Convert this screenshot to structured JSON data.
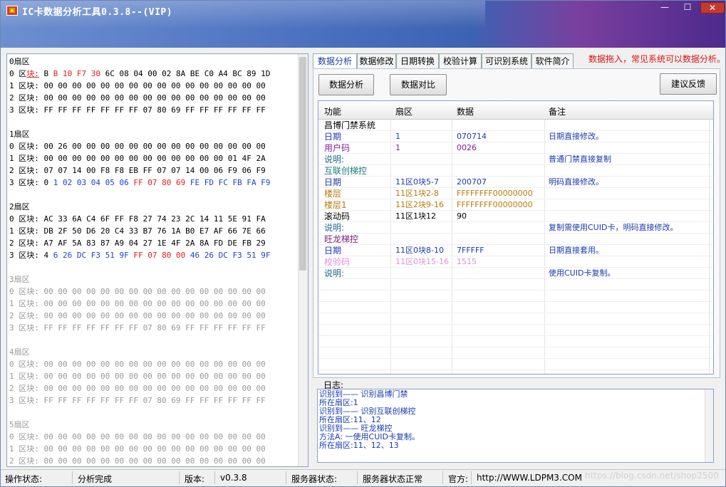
{
  "window": {
    "title": "IC卡数据分析工具0.3.8--(VIP)",
    "min": "—",
    "max": "☐",
    "close": "✕"
  },
  "hex": {
    "lines": [
      [
        "0扇区",
        ""
      ],
      [
        "0 区块: BB 10 F7 30 6C 08 04 00 02 8A BE C0 A4 BC 89 1D",
        "first"
      ],
      [
        "1 区块: 00 00 00 00 00 00 00 00 00 00 00 00 00 00 00 00",
        ""
      ],
      [
        "2 区块: 00 00 00 00 00 00 00 00 00 00 00 00 00 00 00 00",
        ""
      ],
      [
        "3 区块: FF FF FF FF FF FF FF 07 80 69 FF FF FF FF FF FF",
        ""
      ],
      [
        "",
        ""
      ],
      [
        "1扇区",
        ""
      ],
      [
        "0 区块: 00 26 00 00 00 00 00 00 00 00 00 00 00 00 00 00",
        ""
      ],
      [
        "1 区块: 00 00 00 00 00 00 00 00 00 00 00 00 00 01 4F 2A",
        ""
      ],
      [
        "2 区块: 07 07 14 00 F8 F8 EB FF 07 07 14 00 06 F9 06 F9",
        ""
      ],
      [
        "3 区块: 01 02 03 04 05 06 FF 07 80 69 FE FD FC FB FA F9",
        "trailer"
      ],
      [
        "",
        ""
      ],
      [
        "2扇区",
        ""
      ],
      [
        "0 区块: AC 33 6A C4 6F FF F8 27 74 23 2C 14 11 5E 91 FA",
        ""
      ],
      [
        "1 区块: DB 2F 50 D6 20 C4 33 B7 76 1A B0 E7 AF 66 7E 66",
        ""
      ],
      [
        "2 区块: A7 AF 5A 83 87 A9 04 27 1E 4F 2A 8A FD DE FB 29",
        ""
      ],
      [
        "3 区块: 46 26 DC F3 51 9F FF 07 80 00 46 26 DC F3 51 9F",
        "trailer"
      ],
      [
        "",
        ""
      ],
      [
        "3扇区",
        "gray"
      ],
      [
        "0 区块: 00 00 00 00 00 00 00 00 00 00 00 00 00 00 00 00",
        "gray"
      ],
      [
        "1 区块: 00 00 00 00 00 00 00 00 00 00 00 00 00 00 00 00",
        "gray"
      ],
      [
        "2 区块: 00 00 00 00 00 00 00 00 00 00 00 00 00 00 00 00",
        "gray"
      ],
      [
        "3 区块: FF FF FF FF FF FF FF 07 80 69 FF FF FF FF FF FF",
        "gray"
      ],
      [
        "",
        ""
      ],
      [
        "4扇区",
        "gray"
      ],
      [
        "0 区块: 00 00 00 00 00 00 00 00 00 00 00 00 00 00 00 00",
        "gray"
      ],
      [
        "1 区块: 00 00 00 00 00 00 00 00 00 00 00 00 00 00 00 00",
        "gray"
      ],
      [
        "2 区块: 00 00 00 00 00 00 00 00 00 00 00 00 00 00 00 00",
        "gray"
      ],
      [
        "3 区块: FF FF FF FF FF FF FF 07 80 69 FF FF FF FF FF FF",
        "gray"
      ],
      [
        "",
        ""
      ],
      [
        "5扇区",
        "gray"
      ],
      [
        "0 区块: 00 00 00 00 00 00 00 00 00 00 00 00 00 00 00 00",
        "gray"
      ],
      [
        "1 区块: 00 00 00 00 00 00 00 00 00 00 00 00 00 00 00 00",
        "gray"
      ],
      [
        "2 区块: 00 00 00 00 00 00 00 00 00 00 00 00 00 00 00 00",
        "gray"
      ]
    ]
  },
  "tabs": [
    "数据分析",
    "数据修改",
    "日期转换",
    "校验计算",
    "可识别系统",
    "软件简介"
  ],
  "hint": "数据拖入，常见系统可以数据分析。",
  "buttons": {
    "analyze": "数据分析",
    "compare": "数据对比",
    "feedback": "建议反馈"
  },
  "grid": {
    "headers": [
      "功能",
      "扇区",
      "数据",
      "备注"
    ],
    "rows": [
      {
        "c": [
          "昌博门禁系统",
          "",
          "",
          ""
        ],
        "color": "#000"
      },
      {
        "c": [
          "日期",
          "1",
          "070714",
          "日期直接修改。"
        ],
        "color": "#1a3ab0"
      },
      {
        "c": [
          "用户码",
          "1",
          "0026",
          ""
        ],
        "color": "#8a1a9a"
      },
      {
        "c": [
          "说明:",
          "",
          "",
          "普通门禁直接复制"
        ],
        "color": "#1a6a8a"
      },
      {
        "c": [
          "互联创梯控",
          "",
          "",
          ""
        ],
        "color": "#1a7a7a"
      },
      {
        "c": [
          "日期",
          "11区0块5-7",
          "200707",
          "明码直接修改。"
        ],
        "color": "#1a3ab0"
      },
      {
        "c": [
          "楼层",
          "11区1块2-8",
          "FFFFFFFF00000000",
          ""
        ],
        "color": "#b87a0a"
      },
      {
        "c": [
          "楼层1",
          "11区2块9-16",
          "FFFFFFFF00000000",
          ""
        ],
        "color": "#b87a0a"
      },
      {
        "c": [
          "滚动码",
          "11区1块12",
          "90",
          ""
        ],
        "color": "#000"
      },
      {
        "c": [
          "说明:",
          "",
          "",
          "复制需使用CUID卡，明码直接修改。"
        ],
        "color": "#1a6a8a"
      },
      {
        "c": [
          "旺龙梯控",
          "",
          "",
          ""
        ],
        "color": "#7a1a7a"
      },
      {
        "c": [
          "日期",
          "11区0块8-10",
          "7FFFFF",
          "日期直接套用。"
        ],
        "color": "#1a3ab0"
      },
      {
        "c": [
          "校验码",
          "11区0块15-16",
          "1515",
          ""
        ],
        "color": "#e090d8"
      },
      {
        "c": [
          "说明:",
          "",
          "",
          "使用CUID卡复制。"
        ],
        "color": "#1a6a8a"
      }
    ]
  },
  "log": {
    "label": "日志:",
    "lines": [
      "识别到—— 识别昌博门禁",
      "所在扇区:1",
      "识别到—— 识别互联创梯控",
      "所在扇区:11、12",
      "识别到—— 旺龙梯控",
      "方法A: 一使用CUID卡复制。",
      "所在扇区:11、12、13"
    ]
  },
  "status": {
    "op_label": "操作状态:",
    "op_value": "分析完成",
    "ver_label": "版本:",
    "ver_value": "v0.3.8",
    "srv_label": "服务器状态:",
    "srv_value": "服务器状态正常",
    "site_label": "官方:",
    "site_value": "http://WWW.LDPM3.COM"
  },
  "watermark": "https://blog.csdn.net/shop2500"
}
